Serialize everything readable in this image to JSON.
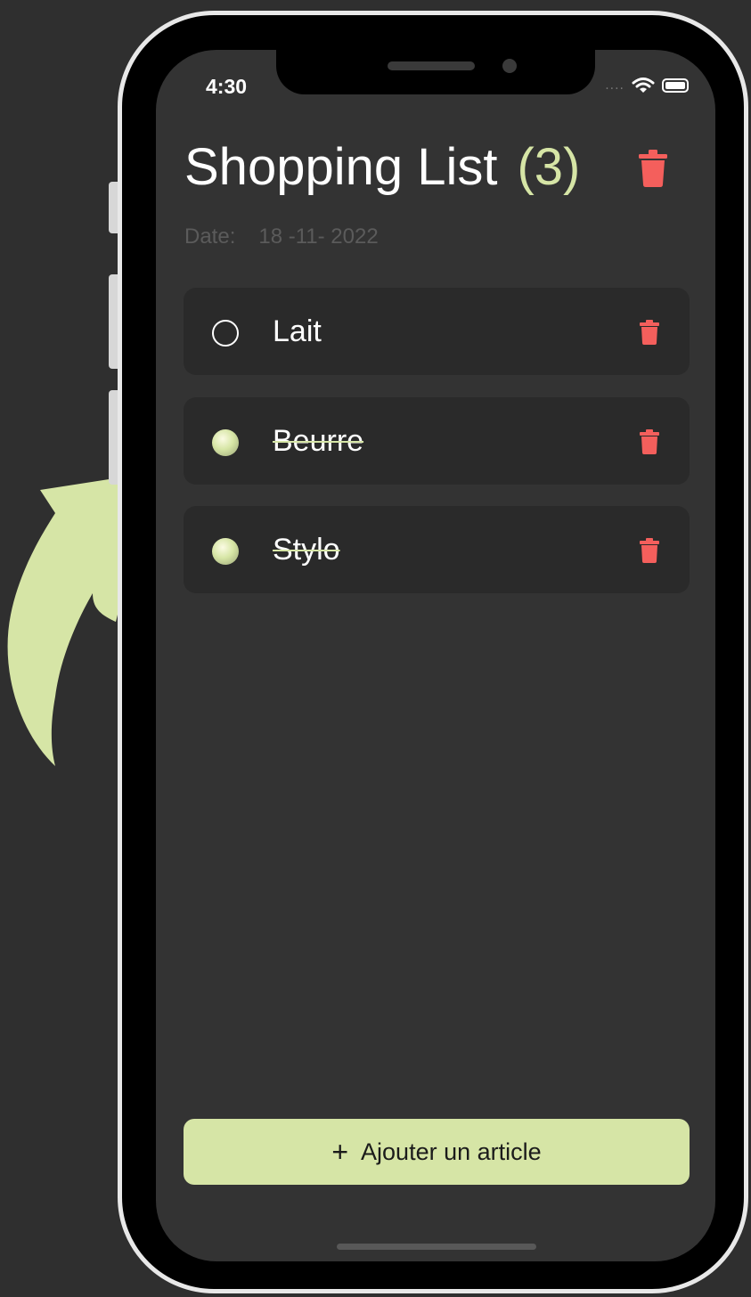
{
  "status_bar": {
    "time": "4:30",
    "signal": "....",
    "icons": [
      "wifi-icon",
      "battery-icon"
    ]
  },
  "header": {
    "title": "Shopping List",
    "count": "(3)",
    "delete_all_icon": "trash-icon"
  },
  "date": {
    "label": "Date:",
    "value": "18 -11- 2022"
  },
  "items": [
    {
      "label": "Lait",
      "checked": false
    },
    {
      "label": "Beurre",
      "checked": true
    },
    {
      "label": "Stylo",
      "checked": true
    }
  ],
  "add_button": {
    "icon": "+",
    "label": "Ajouter un article"
  },
  "colors": {
    "accent": "#d6e5a6",
    "danger": "#f45f5c",
    "background": "#333333",
    "item_background": "#2a2a2a",
    "page_background": "#2f2f2f"
  }
}
